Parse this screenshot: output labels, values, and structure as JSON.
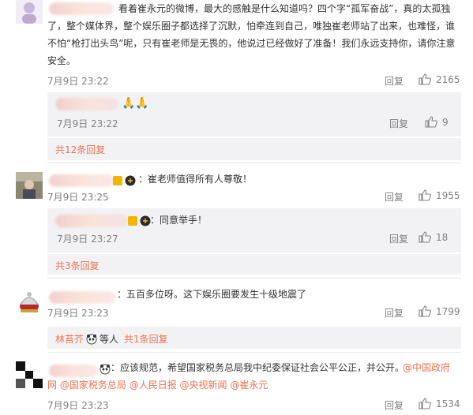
{
  "comments": [
    {
      "text_lines": [
        "看着崔永元的微博，最大的感触是什么知道吗？四个字“孤军奋战”，真的太孤独",
        "了，整个媒体界，整个娱乐圈子都选择了沉默，怕牵连到自己，唯独崔老师站了出来，也难怪，谁",
        "不怕“枪打出头鸟”呢，只有崔老师是无畏的，他说过已经做好了准备！我们永远支持你，请你注意",
        "安全。"
      ],
      "time": "7月9日 23:22",
      "reply": "回复",
      "likes": "2165",
      "sub": {
        "text": "🙏🙏",
        "time": "7月9日 23:22",
        "reply": "回复",
        "likes": "9"
      },
      "more": "共12条回复"
    },
    {
      "text": "：崔老师值得所有人尊敬！",
      "time": "7月9日 23:25",
      "reply": "回复",
      "likes": "1955",
      "sub": {
        "text": "：同意举手！",
        "time": "7月9日 23:27",
        "reply": "回复",
        "likes": "18"
      },
      "more": "共3条回复"
    },
    {
      "text": "：五百多位呀。这下娱乐圈要发生十级地震了",
      "time": "7月9日 23:23",
      "reply": "回复",
      "likes": "1799",
      "more_user": "林苔芥",
      "more_mid": "等人",
      "more": "共1条回复"
    },
    {
      "text": "：应该规范，希望国家税务总局我中纪委保证社会公平公正，并公开。",
      "mentions": [
        "@中国政府网",
        "@国家税务总局",
        "@人民日报",
        "@央视新闻",
        "@崔永元"
      ],
      "time": "7月9日 23:23",
      "reply": "回复",
      "likes": "1534"
    }
  ],
  "colors": {
    "link": "#eb7350",
    "meta": "#808080",
    "text": "#333333",
    "subbox": "#f2f2f5"
  },
  "icons": {
    "like": "thumbs-up-icon",
    "badge": "verified-badge-icon"
  }
}
